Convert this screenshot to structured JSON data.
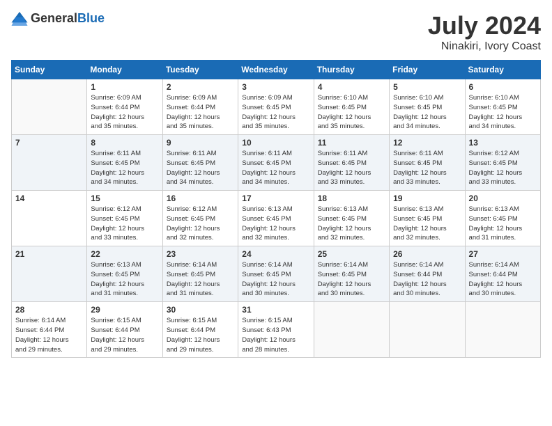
{
  "header": {
    "logo_general": "General",
    "logo_blue": "Blue",
    "month_year": "July 2024",
    "location": "Ninakiri, Ivory Coast"
  },
  "days_of_week": [
    "Sunday",
    "Monday",
    "Tuesday",
    "Wednesday",
    "Thursday",
    "Friday",
    "Saturday"
  ],
  "weeks": [
    [
      {
        "day": "",
        "info": ""
      },
      {
        "day": "1",
        "info": "Sunrise: 6:09 AM\nSunset: 6:44 PM\nDaylight: 12 hours\nand 35 minutes."
      },
      {
        "day": "2",
        "info": "Sunrise: 6:09 AM\nSunset: 6:44 PM\nDaylight: 12 hours\nand 35 minutes."
      },
      {
        "day": "3",
        "info": "Sunrise: 6:09 AM\nSunset: 6:45 PM\nDaylight: 12 hours\nand 35 minutes."
      },
      {
        "day": "4",
        "info": "Sunrise: 6:10 AM\nSunset: 6:45 PM\nDaylight: 12 hours\nand 35 minutes."
      },
      {
        "day": "5",
        "info": "Sunrise: 6:10 AM\nSunset: 6:45 PM\nDaylight: 12 hours\nand 34 minutes."
      },
      {
        "day": "6",
        "info": "Sunrise: 6:10 AM\nSunset: 6:45 PM\nDaylight: 12 hours\nand 34 minutes."
      }
    ],
    [
      {
        "day": "7",
        "info": ""
      },
      {
        "day": "8",
        "info": "Sunrise: 6:11 AM\nSunset: 6:45 PM\nDaylight: 12 hours\nand 34 minutes."
      },
      {
        "day": "9",
        "info": "Sunrise: 6:11 AM\nSunset: 6:45 PM\nDaylight: 12 hours\nand 34 minutes."
      },
      {
        "day": "10",
        "info": "Sunrise: 6:11 AM\nSunset: 6:45 PM\nDaylight: 12 hours\nand 34 minutes."
      },
      {
        "day": "11",
        "info": "Sunrise: 6:11 AM\nSunset: 6:45 PM\nDaylight: 12 hours\nand 33 minutes."
      },
      {
        "day": "12",
        "info": "Sunrise: 6:11 AM\nSunset: 6:45 PM\nDaylight: 12 hours\nand 33 minutes."
      },
      {
        "day": "13",
        "info": "Sunrise: 6:12 AM\nSunset: 6:45 PM\nDaylight: 12 hours\nand 33 minutes."
      }
    ],
    [
      {
        "day": "14",
        "info": ""
      },
      {
        "day": "15",
        "info": "Sunrise: 6:12 AM\nSunset: 6:45 PM\nDaylight: 12 hours\nand 33 minutes."
      },
      {
        "day": "16",
        "info": "Sunrise: 6:12 AM\nSunset: 6:45 PM\nDaylight: 12 hours\nand 32 minutes."
      },
      {
        "day": "17",
        "info": "Sunrise: 6:13 AM\nSunset: 6:45 PM\nDaylight: 12 hours\nand 32 minutes."
      },
      {
        "day": "18",
        "info": "Sunrise: 6:13 AM\nSunset: 6:45 PM\nDaylight: 12 hours\nand 32 minutes."
      },
      {
        "day": "19",
        "info": "Sunrise: 6:13 AM\nSunset: 6:45 PM\nDaylight: 12 hours\nand 32 minutes."
      },
      {
        "day": "20",
        "info": "Sunrise: 6:13 AM\nSunset: 6:45 PM\nDaylight: 12 hours\nand 31 minutes."
      }
    ],
    [
      {
        "day": "21",
        "info": ""
      },
      {
        "day": "22",
        "info": "Sunrise: 6:13 AM\nSunset: 6:45 PM\nDaylight: 12 hours\nand 31 minutes."
      },
      {
        "day": "23",
        "info": "Sunrise: 6:14 AM\nSunset: 6:45 PM\nDaylight: 12 hours\nand 31 minutes."
      },
      {
        "day": "24",
        "info": "Sunrise: 6:14 AM\nSunset: 6:45 PM\nDaylight: 12 hours\nand 30 minutes."
      },
      {
        "day": "25",
        "info": "Sunrise: 6:14 AM\nSunset: 6:45 PM\nDaylight: 12 hours\nand 30 minutes."
      },
      {
        "day": "26",
        "info": "Sunrise: 6:14 AM\nSunset: 6:44 PM\nDaylight: 12 hours\nand 30 minutes."
      },
      {
        "day": "27",
        "info": "Sunrise: 6:14 AM\nSunset: 6:44 PM\nDaylight: 12 hours\nand 30 minutes."
      }
    ],
    [
      {
        "day": "28",
        "info": "Sunrise: 6:14 AM\nSunset: 6:44 PM\nDaylight: 12 hours\nand 29 minutes."
      },
      {
        "day": "29",
        "info": "Sunrise: 6:15 AM\nSunset: 6:44 PM\nDaylight: 12 hours\nand 29 minutes."
      },
      {
        "day": "30",
        "info": "Sunrise: 6:15 AM\nSunset: 6:44 PM\nDaylight: 12 hours\nand 29 minutes."
      },
      {
        "day": "31",
        "info": "Sunrise: 6:15 AM\nSunset: 6:43 PM\nDaylight: 12 hours\nand 28 minutes."
      },
      {
        "day": "",
        "info": ""
      },
      {
        "day": "",
        "info": ""
      },
      {
        "day": "",
        "info": ""
      }
    ]
  ]
}
